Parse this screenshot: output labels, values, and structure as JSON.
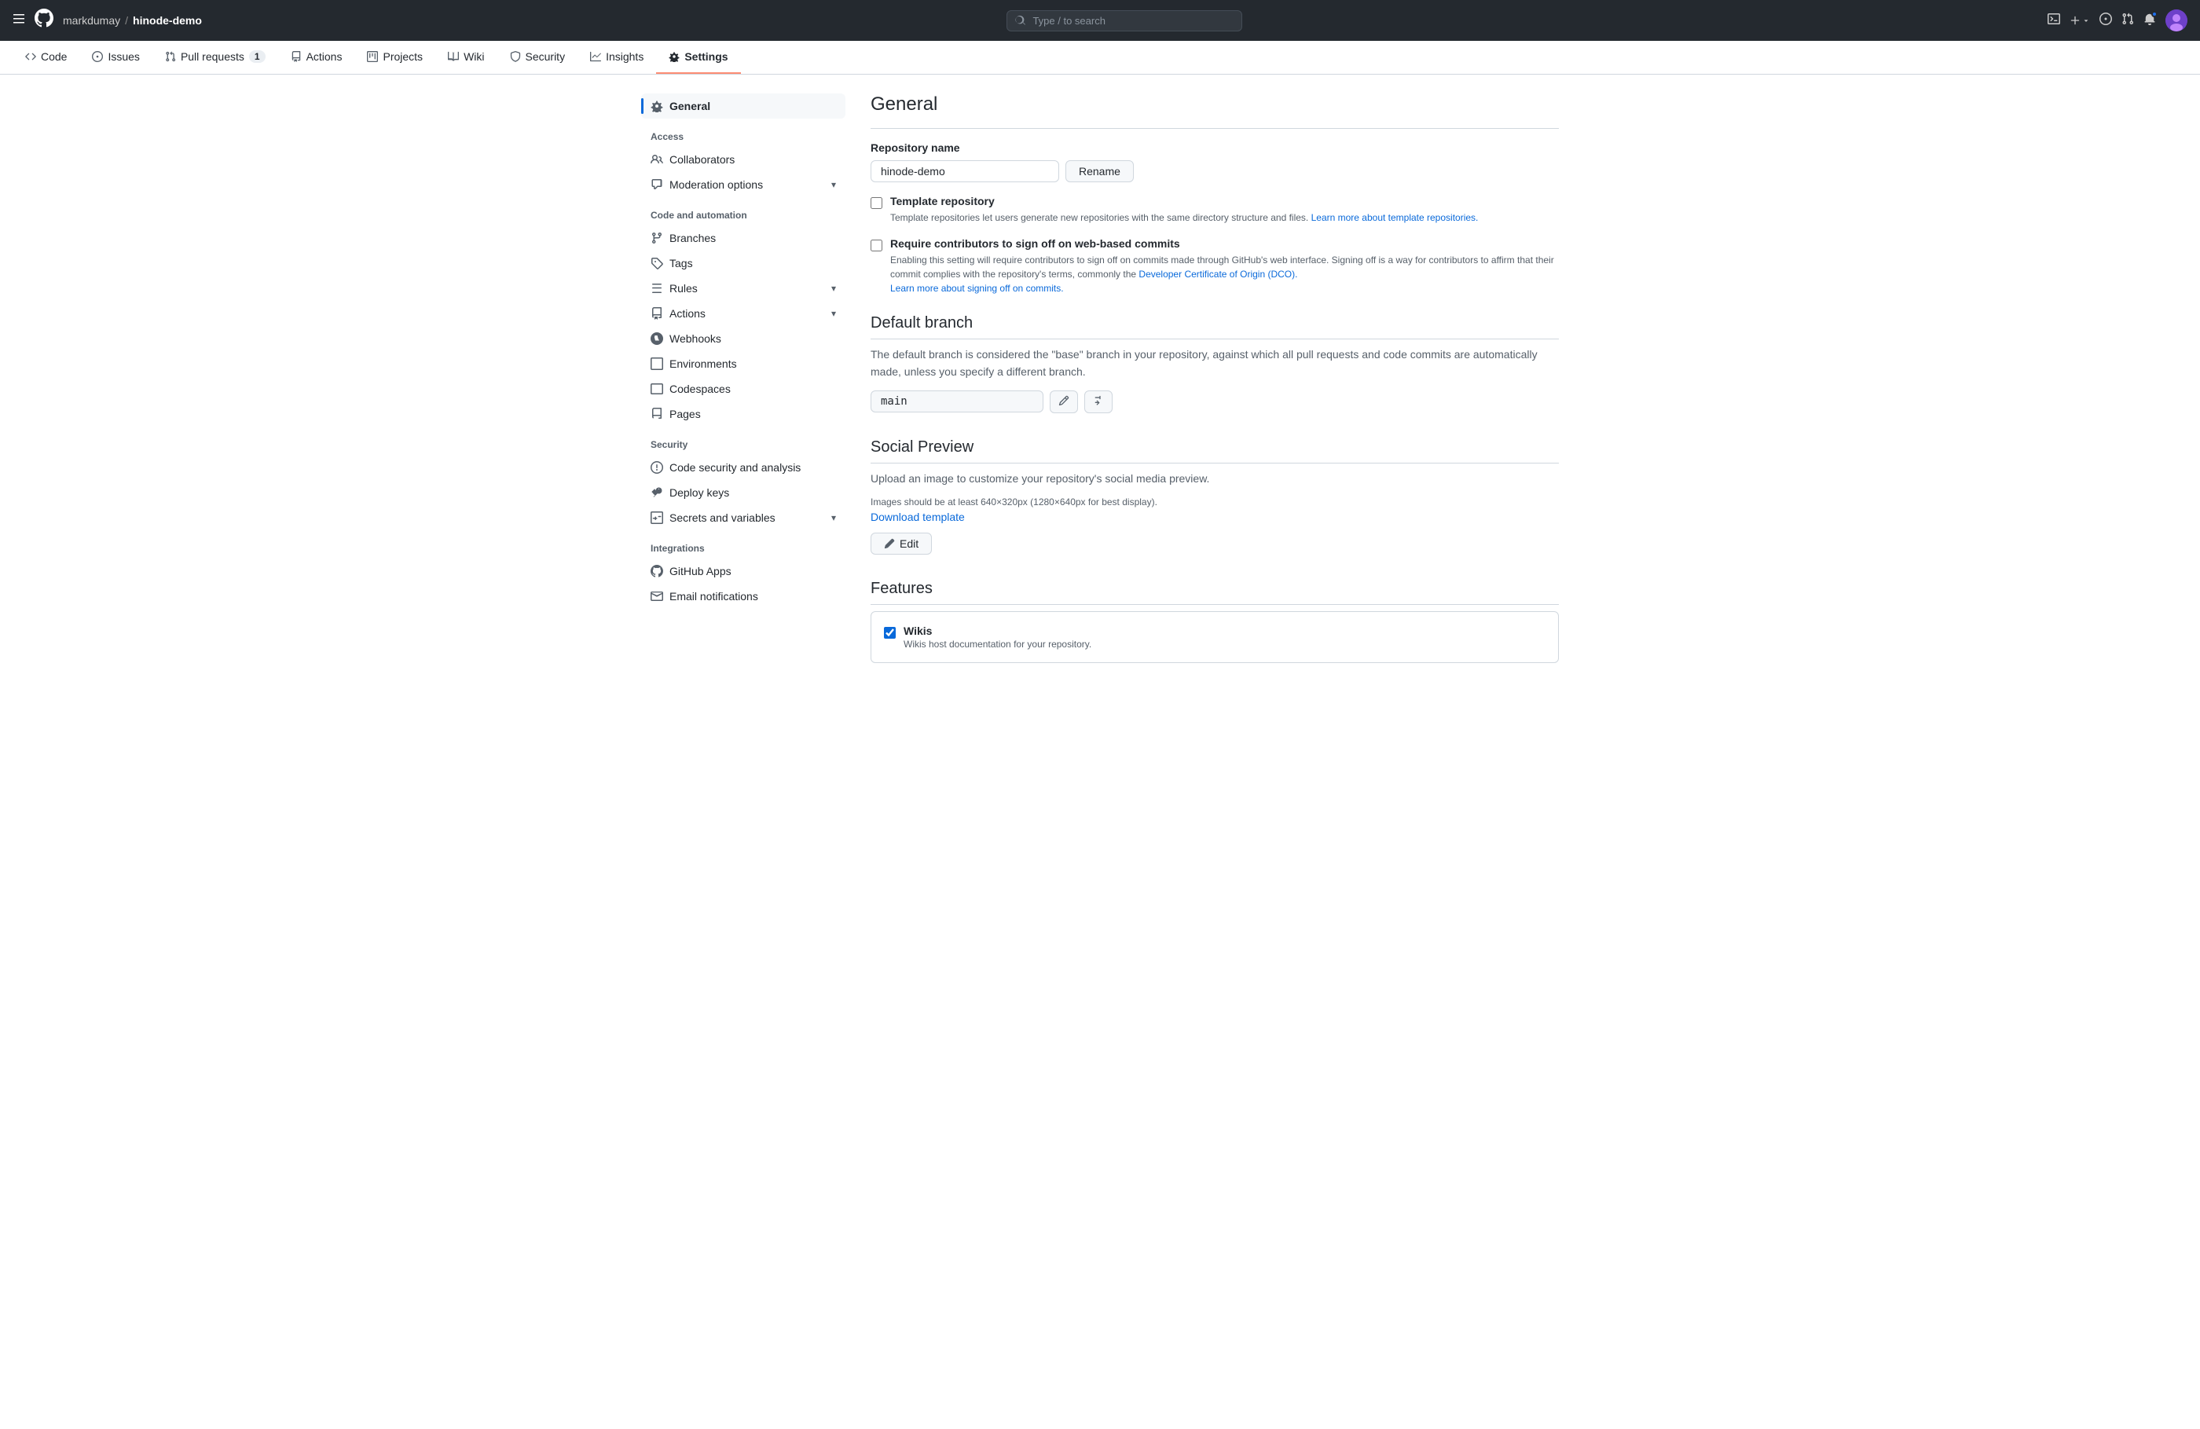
{
  "topBar": {
    "hamburger": "≡",
    "logo": "⬤",
    "owner": "markdumay",
    "separator": "/",
    "repoName": "hinode-demo",
    "search": {
      "placeholder": "Type / to search"
    },
    "icons": {
      "terminal": ">_",
      "plus": "+",
      "issue": "○",
      "pullRequest": "↕",
      "notification": "🔔"
    }
  },
  "navBar": {
    "items": [
      {
        "id": "code",
        "label": "Code",
        "icon": "<>",
        "badge": null,
        "active": false
      },
      {
        "id": "issues",
        "label": "Issues",
        "icon": "○",
        "badge": null,
        "active": false
      },
      {
        "id": "pull-requests",
        "label": "Pull requests",
        "icon": "↕",
        "badge": "1",
        "active": false
      },
      {
        "id": "actions",
        "label": "Actions",
        "icon": "▶",
        "badge": null,
        "active": false
      },
      {
        "id": "projects",
        "label": "Projects",
        "icon": "⊞",
        "badge": null,
        "active": false
      },
      {
        "id": "wiki",
        "label": "Wiki",
        "icon": "📖",
        "badge": null,
        "active": false
      },
      {
        "id": "security",
        "label": "Security",
        "icon": "🛡",
        "badge": null,
        "active": false
      },
      {
        "id": "insights",
        "label": "Insights",
        "icon": "📈",
        "badge": null,
        "active": false
      },
      {
        "id": "settings",
        "label": "Settings",
        "icon": "⚙",
        "badge": null,
        "active": true
      }
    ]
  },
  "sidebar": {
    "sections": [
      {
        "items": [
          {
            "id": "general",
            "label": "General",
            "icon": "⚙",
            "active": true,
            "hasChevron": false
          }
        ]
      },
      {
        "label": "Access",
        "items": [
          {
            "id": "collaborators",
            "label": "Collaborators",
            "icon": "👤",
            "active": false,
            "hasChevron": false
          },
          {
            "id": "moderation-options",
            "label": "Moderation options",
            "icon": "💬",
            "active": false,
            "hasChevron": true
          }
        ]
      },
      {
        "label": "Code and automation",
        "items": [
          {
            "id": "branches",
            "label": "Branches",
            "icon": "⑂",
            "active": false,
            "hasChevron": false
          },
          {
            "id": "tags",
            "label": "Tags",
            "icon": "🏷",
            "active": false,
            "hasChevron": false
          },
          {
            "id": "rules",
            "label": "Rules",
            "icon": "📋",
            "active": false,
            "hasChevron": true
          },
          {
            "id": "actions",
            "label": "Actions",
            "icon": "▶",
            "active": false,
            "hasChevron": true
          },
          {
            "id": "webhooks",
            "label": "Webhooks",
            "icon": "🔗",
            "active": false,
            "hasChevron": false
          },
          {
            "id": "environments",
            "label": "Environments",
            "icon": "⊞",
            "active": false,
            "hasChevron": false
          },
          {
            "id": "codespaces",
            "label": "Codespaces",
            "icon": "⊟",
            "active": false,
            "hasChevron": false
          },
          {
            "id": "pages",
            "label": "Pages",
            "icon": "📄",
            "active": false,
            "hasChevron": false
          }
        ]
      },
      {
        "label": "Security",
        "items": [
          {
            "id": "code-security",
            "label": "Code security and analysis",
            "icon": "🔍",
            "active": false,
            "hasChevron": false
          },
          {
            "id": "deploy-keys",
            "label": "Deploy keys",
            "icon": "🔑",
            "active": false,
            "hasChevron": false
          },
          {
            "id": "secrets-variables",
            "label": "Secrets and variables",
            "icon": "⊞",
            "active": false,
            "hasChevron": true
          }
        ]
      },
      {
        "label": "Integrations",
        "items": [
          {
            "id": "github-apps",
            "label": "GitHub Apps",
            "icon": "⬤",
            "active": false,
            "hasChevron": false
          },
          {
            "id": "email-notifications",
            "label": "Email notifications",
            "icon": "✉",
            "active": false,
            "hasChevron": false
          }
        ]
      }
    ]
  },
  "content": {
    "pageTitle": "General",
    "repositoryName": {
      "label": "Repository name",
      "value": "hinode-demo",
      "renameBtn": "Rename"
    },
    "templateRepository": {
      "label": "Template repository",
      "description": "Template repositories let users generate new repositories with the same directory structure and files.",
      "learnMoreText": "Learn more about template repositories.",
      "checked": false
    },
    "signOff": {
      "label": "Require contributors to sign off on web-based commits",
      "description": "Enabling this setting will require contributors to sign off on commits made through GitHub's web interface. Signing off is a way for contributors to affirm that their commit complies with the repository's terms, commonly the",
      "dcaLink": "Developer Certificate of Origin (DCO).",
      "learnMoreText": "Learn more about signing off on commits.",
      "checked": false
    },
    "defaultBranch": {
      "sectionTitle": "Default branch",
      "description": "The default branch is considered the \"base\" branch in your repository, against which all pull requests and code commits are automatically made, unless you specify a different branch.",
      "value": "main"
    },
    "socialPreview": {
      "sectionTitle": "Social Preview",
      "description1": "Upload an image to customize your repository's social media preview.",
      "description2": "Images should be at least 640×320px (1280×640px for best display).",
      "downloadTemplate": "Download template",
      "editBtn": "Edit"
    },
    "features": {
      "sectionTitle": "Features",
      "wikis": {
        "label": "Wikis",
        "description": "Wikis host documentation for your repository.",
        "checked": true
      }
    }
  }
}
